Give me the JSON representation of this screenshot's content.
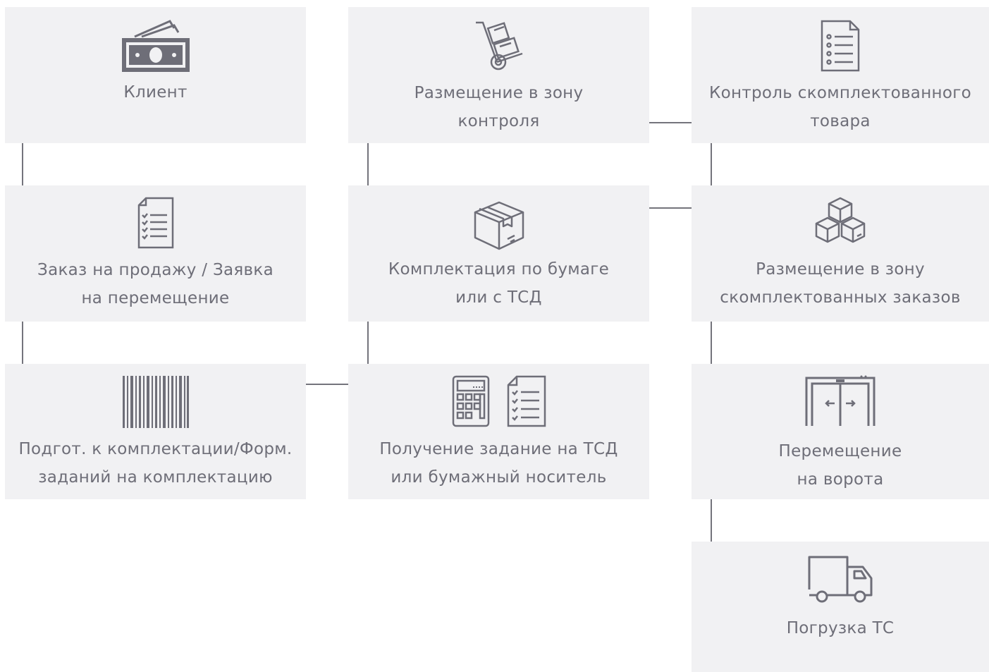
{
  "nodes": {
    "client": {
      "lines": [
        "Клиент"
      ],
      "icon": "money-icon"
    },
    "order": {
      "lines": [
        "Заказ на продажу / Заявка",
        "на перемещение"
      ],
      "icon": "checklist-icon"
    },
    "prep": {
      "lines": [
        "Подгот. к комплектации/Форм.",
        "заданий на комплектацию"
      ],
      "icon": "barcode-icon"
    },
    "receive": {
      "lines": [
        "Получение задание на ТСД",
        "или бумажный носитель"
      ],
      "icon": "calculator-document-icon"
    },
    "pick": {
      "lines": [
        "Комплектация по бумаге",
        "или с ТСД"
      ],
      "icon": "package-box-icon"
    },
    "place_control": {
      "lines": [
        "Размещение в зону",
        "контроля"
      ],
      "icon": "hand-truck-icon"
    },
    "control": {
      "lines": [
        "Контроль скомплектованного",
        "товара"
      ],
      "icon": "list-document-icon"
    },
    "place_picked": {
      "lines": [
        "Размещение в зону",
        "скомплектованных заказов"
      ],
      "icon": "stacked-boxes-icon"
    },
    "move_gate": {
      "lines": [
        "Перемещение",
        "на ворота"
      ],
      "icon": "sliding-gate-icon"
    },
    "loading": {
      "lines": [
        "Погрузка ТС"
      ],
      "icon": "truck-icon"
    }
  },
  "colors": {
    "box_fill": "#f1f1f3",
    "icon_stroke": "#6e6e78",
    "connector": "#74747c",
    "text": "#6e6e78"
  }
}
